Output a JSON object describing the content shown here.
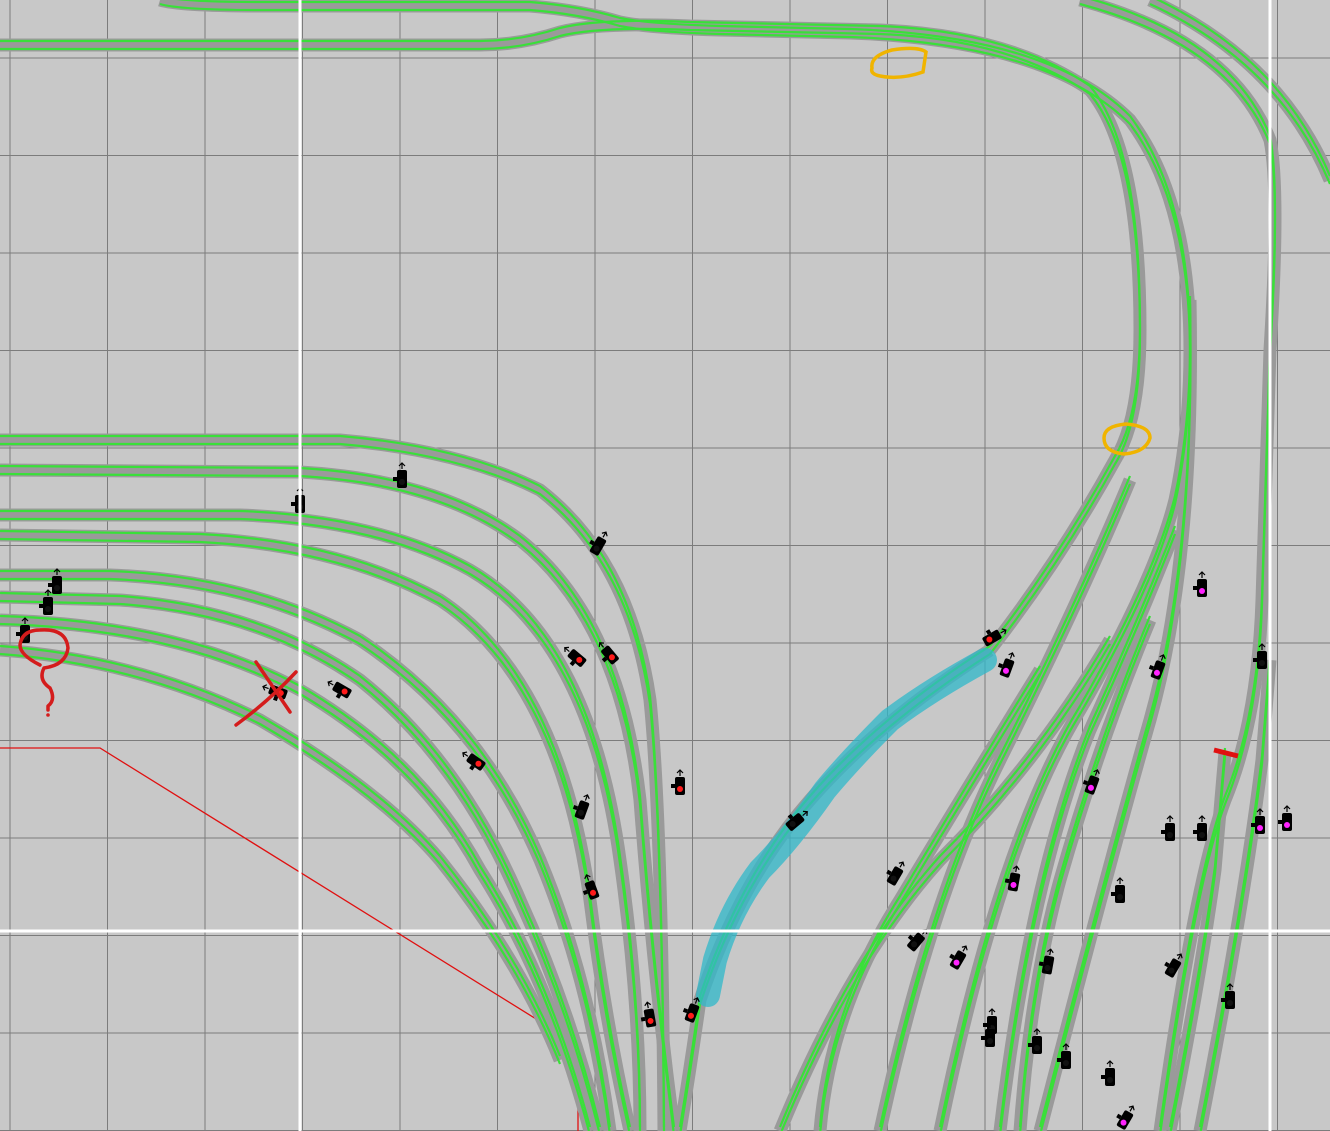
{
  "colors": {
    "background": "#c8c8c8",
    "grid": "#7c7c7c",
    "grid_major": "#ffffff",
    "track_bed": "#9a9a9a",
    "track_rail": "#39e039",
    "signal_red": "#ff1a1a",
    "signal_magenta": "#ff22ff",
    "annotation_red": "#d41c1c",
    "annotation_orange": "#f0b400",
    "annotation_blue": "#2fb8c9",
    "zone_boundary": "#e01010"
  },
  "icons": {
    "signal": "railway-signal-icon",
    "buffer_stop": "buffer-stop-icon"
  },
  "annotations": {
    "question_mark": "?"
  },
  "signals": {
    "red_aspect": 11,
    "magenta_aspect": 10,
    "dark_aspect": 21
  }
}
